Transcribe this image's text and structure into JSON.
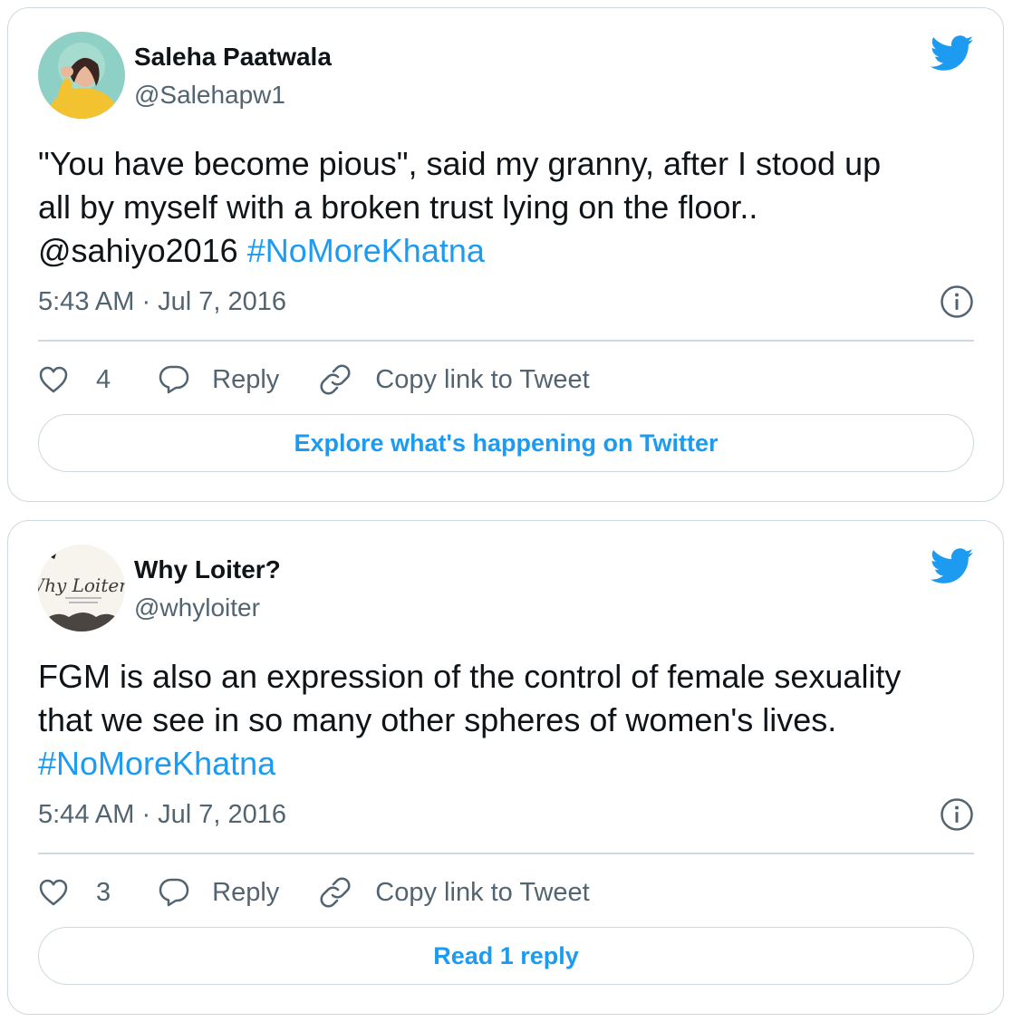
{
  "colors": {
    "accent": "#1d9bf0",
    "text_primary": "#0f1419",
    "text_secondary": "#536471",
    "border": "#cfd9de"
  },
  "tweets": [
    {
      "author": {
        "name": "Saleha Paatwala",
        "handle": "@Salehapw1"
      },
      "text_lines": [
        {
          "text": "\"You have become pious\", said my granny, after I stood up"
        },
        {
          "text": "all by myself with a broken trust lying on the floor.."
        },
        {
          "mention": "@sahiyo2016",
          "hashtag": "#NoMoreKhatna"
        }
      ],
      "timestamp": "5:43 AM · Jul 7, 2016",
      "likes": "4",
      "reply_label": "Reply",
      "copy_link_label": "Copy link to Tweet",
      "bottom_button": "Explore what's happening on Twitter",
      "icons": [
        "twitter-bird-icon",
        "info-icon",
        "heart-icon",
        "reply-bubble-icon",
        "link-icon"
      ]
    },
    {
      "author": {
        "name": "Why Loiter?",
        "handle": "@whyloiter"
      },
      "text_lines": [
        {
          "text": "FGM is also an expression of the control of female sexuality"
        },
        {
          "text": "that we see in so many other spheres of women's lives."
        },
        {
          "hashtag": "#NoMoreKhatna"
        }
      ],
      "timestamp": "5:44 AM · Jul 7, 2016",
      "likes": "3",
      "reply_label": "Reply",
      "copy_link_label": "Copy link to Tweet",
      "bottom_button": "Read 1 reply",
      "avatar_logo_text": "Why Loiter?",
      "icons": [
        "twitter-bird-icon",
        "info-icon",
        "heart-icon",
        "reply-bubble-icon",
        "link-icon"
      ]
    }
  ]
}
